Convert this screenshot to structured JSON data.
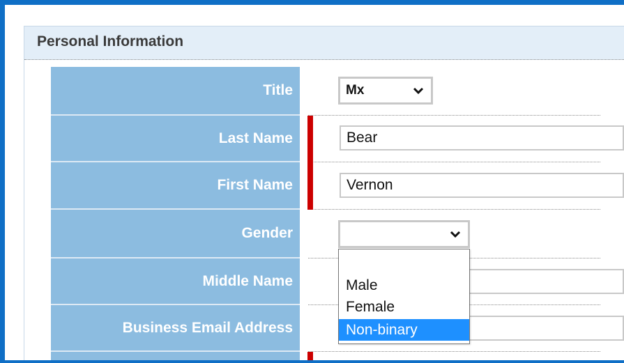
{
  "section": {
    "title": "Personal Information"
  },
  "form": {
    "title": {
      "label": "Title",
      "value": "Mx"
    },
    "last_name": {
      "label": "Last Name",
      "value": "Bear"
    },
    "first_name": {
      "label": "First Name",
      "value": "Vernon"
    },
    "gender": {
      "label": "Gender",
      "value": "",
      "options": [
        "",
        "Male",
        "Female",
        "Non-binary"
      ],
      "highlighted": "Non-binary"
    },
    "middle_name": {
      "label": "Middle Name",
      "value": ""
    },
    "business_email": {
      "label": "Business Email Address",
      "value": ""
    }
  },
  "colors": {
    "frame_border": "#0f6fc6",
    "label_background": "#8cbce0",
    "required_marker": "#cc0000",
    "highlight": "#1e90ff"
  },
  "icons": {
    "select_arrow": "chevron-down-icon"
  }
}
